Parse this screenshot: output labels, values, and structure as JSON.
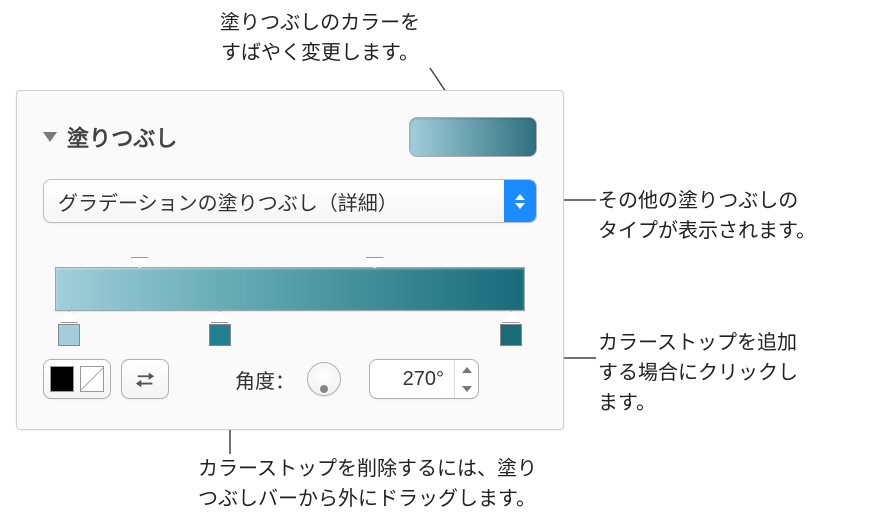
{
  "callouts": {
    "top": "塗りつぶしのカラーを\nすばやく変更します。",
    "rightA": "その他の塗りつぶしの\nタイプが表示されます。",
    "rightB": "カラーストップを追加\nする場合にクリックし\nます。",
    "bottom": "カラーストップを削除するには、塗り\nつぶしバーから外にドラッグします。"
  },
  "panel": {
    "section_title": "塗りつぶし",
    "fill_type": "グラデーションの塗りつぶし（詳細）",
    "angle_label": "角度：",
    "angle_value": "270°",
    "color_well": "#5e9aa8",
    "gradient": {
      "stops": [
        {
          "pos_pct": 3,
          "color": "#a2cedb"
        },
        {
          "pos_pct": 35,
          "color": "#248090"
        },
        {
          "pos_pct": 97,
          "color": "#186b79"
        }
      ],
      "midpoints_pct": [
        18,
        68
      ]
    }
  }
}
